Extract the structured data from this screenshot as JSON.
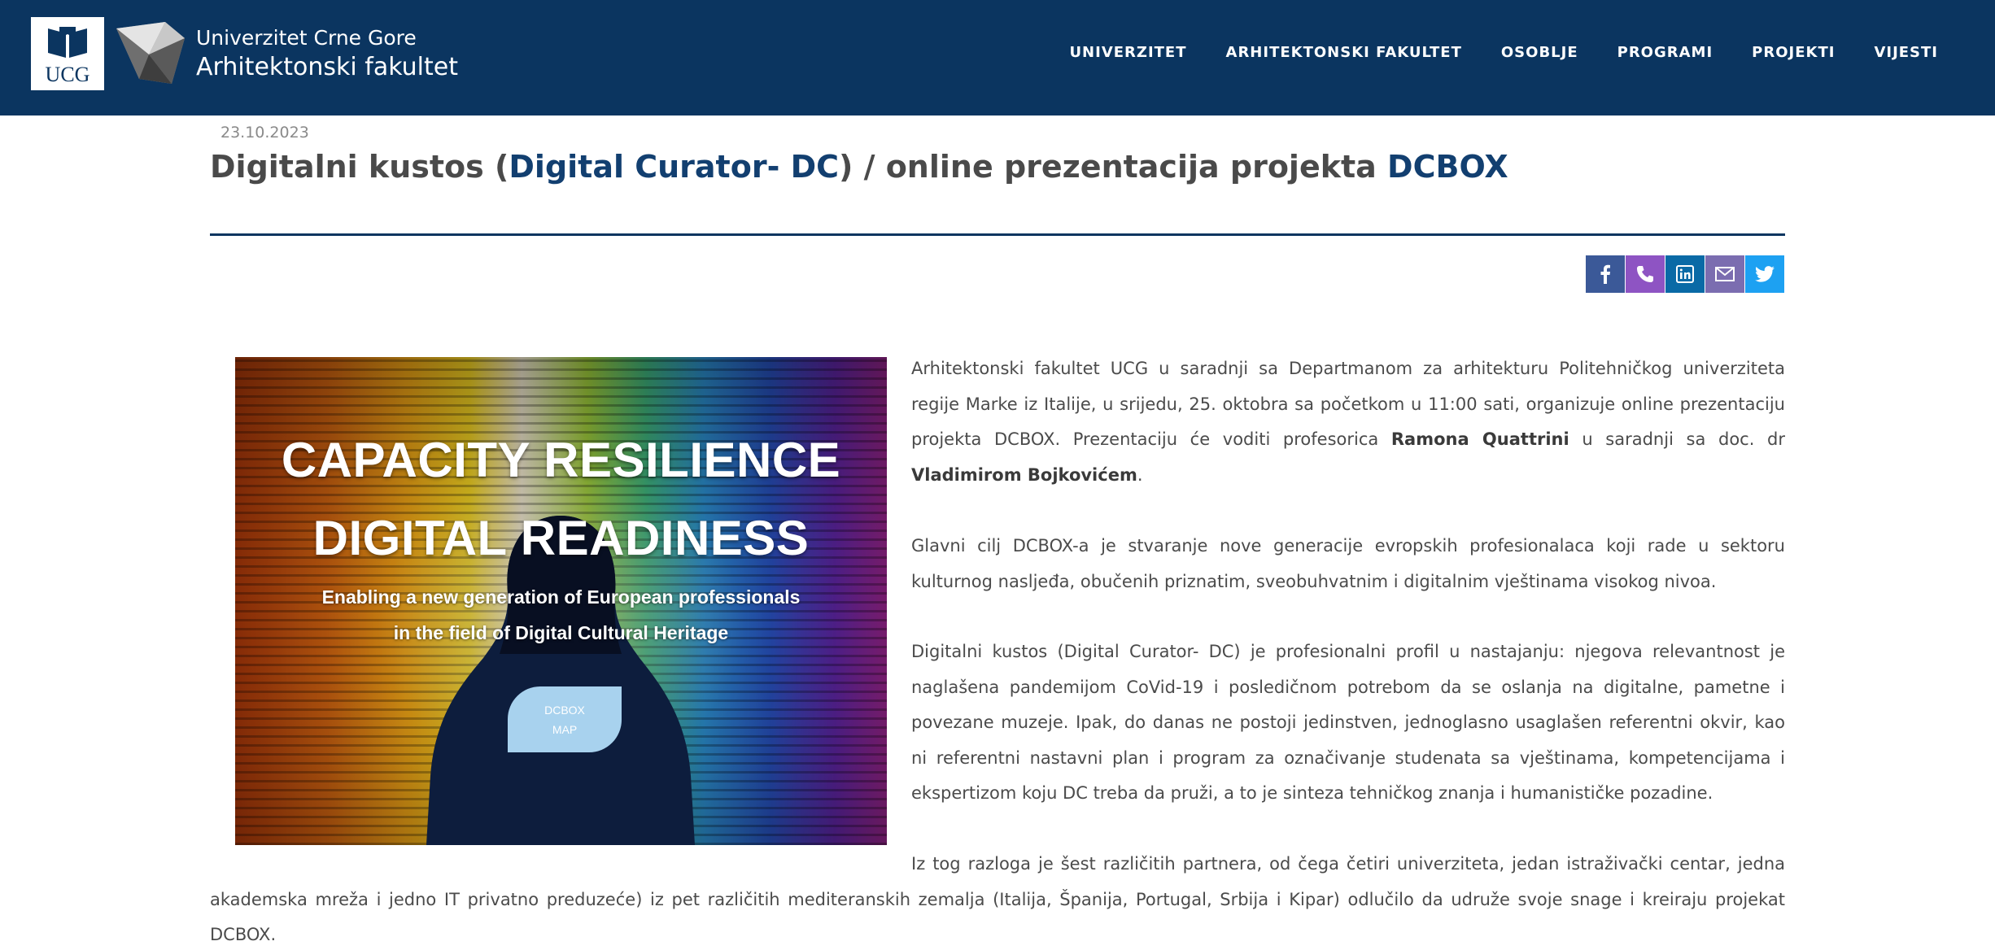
{
  "header": {
    "ucg_logo_text": "UCG",
    "university": "Univerzitet Crne Gore",
    "faculty": "Arhitektonski fakultet",
    "nav": [
      "UNIVERZITET",
      "ARHITEKTONSKI FAKULTET",
      "OSOBLJE",
      "PROGRAMI",
      "PROJEKTI",
      "VIJESTI"
    ],
    "colors": {
      "bar": "#0b3560",
      "accent": "#123f70"
    }
  },
  "article": {
    "date": "23.10.2023",
    "title_part1": "Digitalni kustos (",
    "title_part2": "Digital Curator- DC",
    "title_part3": ") / online prezentacija projekta ",
    "title_part4": "DCBOX",
    "share_icons": [
      "facebook-icon",
      "phone-icon",
      "linkedin-icon",
      "email-icon",
      "twitter-icon"
    ],
    "hero": {
      "line1": "CAPACITY RESILIENCE",
      "line2": "DIGITAL READINESS",
      "sub1": "Enabling a new generation of European professionals",
      "sub2": "in the field of Digital Cultural Heritage",
      "button_line1": "DCBOX",
      "button_line2": "MAP"
    },
    "p1_a": "Arhitektonski fakultet UCG u saradnji sa Departmanom za arhitekturu Politehničkog univerziteta regije Marke iz Italije, u srijedu, 25. oktobra sa početkom u 11:00 sati, organizuje online prezentaciju projekta DCBOX. Prezentaciju će voditi profesorica ",
    "p1_b": "Ramona Quattrini",
    "p1_c": " u saradnji sa doc. dr ",
    "p1_d": "Vladimirom Bojkovićem",
    "p1_e": ".",
    "p2": "Glavni cilj DCBOX-a je stvaranje nove generacije evropskih profesionalaca koji rade u sektoru kulturnog nasljeđa, obučenih priznatim, sveobuhvatnim i digitalnim vještinama visokog nivoa.",
    "p3": "Digitalni kustos (Digital Curator- DC) je profesionalni profil u nastajanju: njegova relevantnost je naglašena pandemijom CoVid-19 i posledičnom potrebom da se oslanja na digitalne, pametne i povezane muzeje. Ipak, do danas ne postoji jedinstven, jednoglasno usaglašen referentni okvir, kao ni referentni nastavni plan i program za označivanje studenata sa vještinama, kompetencijama i ekspertizom koju DC treba da pruži, a to je sinteza tehničkog znanja i humanističke pozadine.",
    "p4": "Iz tog razloga je šest različitih partnera, od čega četiri univerziteta, jedan istraživački centar, jedna akademska mreža i jedno IT privatno preduzeće) iz pet različitih mediteranskih zemalja (Italija, Španija, Portugal, Srbija i Kipar) odlučilo da udruže svoje snage i kreiraju projekat DCBOX."
  }
}
